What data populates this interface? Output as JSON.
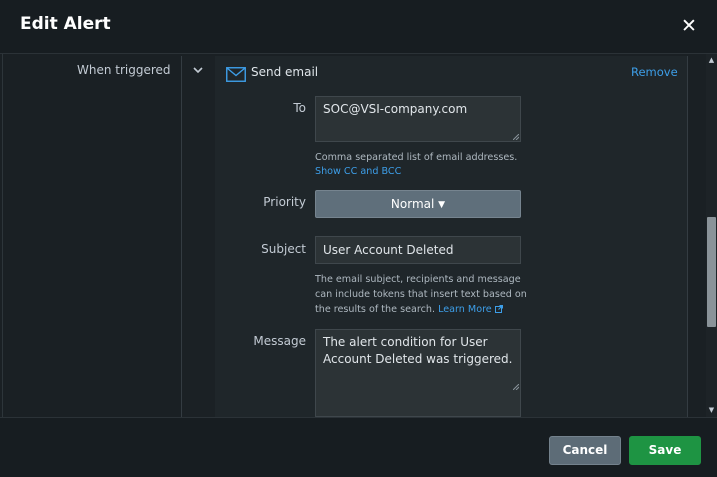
{
  "dialog": {
    "title": "Edit Alert",
    "close_symbol": "✕"
  },
  "trigger": {
    "label": "When triggered"
  },
  "action": {
    "name": "Send email",
    "icon": "envelope-icon",
    "remove_label": "Remove",
    "to": {
      "label": "To",
      "value": "SOC@VSI-company.com",
      "help": "Comma separated list of email addresses.",
      "show_cc_bcc": "Show CC and BCC"
    },
    "priority": {
      "label": "Priority",
      "value": "Normal"
    },
    "subject": {
      "label": "Subject",
      "value": "User Account Deleted",
      "help_line1": "The email subject, recipients and message",
      "help_line2": "can include tokens that insert text based on",
      "help_line3": "the results of the search.",
      "learn_more": "Learn More"
    },
    "message": {
      "label": "Message",
      "value": "The alert condition for User Account Deleted was triggered."
    }
  },
  "footer": {
    "cancel_label": "Cancel",
    "save_label": "Save"
  },
  "colors": {
    "accent_link": "#3d9ee8",
    "save_green": "#1e9443",
    "background": "#171d21"
  }
}
